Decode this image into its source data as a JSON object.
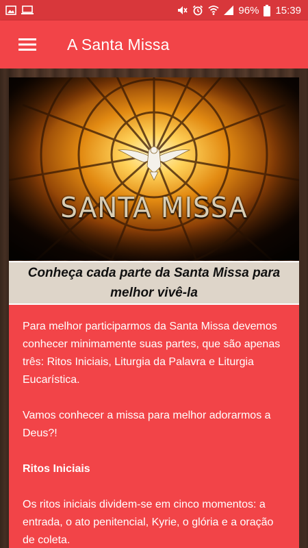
{
  "status_bar": {
    "battery": "96%",
    "time": "15:39",
    "left_icons": [
      "image-icon",
      "monitor-icon"
    ],
    "right_icons": [
      "mute-icon",
      "alarm-icon",
      "wifi-icon",
      "signal-icon",
      "battery-icon"
    ]
  },
  "app_bar": {
    "title": "A Santa Missa",
    "menu_icon": "hamburger-menu-icon"
  },
  "hero": {
    "title": "SANTA MISSA"
  },
  "caption": "Conheça cada parte da Santa Missa para melhor vivê-la",
  "content": {
    "paragraph_1": "Para melhor participarmos da Santa Missa devemos conhecer minimamente suas partes, que são apenas três: Ritos Iniciais, Liturgia da Palavra e Liturgia Eucarística.",
    "paragraph_2": "Vamos conhecer a missa para melhor adorarmos a Deus?!",
    "section_title": "Ritos Iniciais",
    "paragraph_3": "Os ritos iniciais dividem-se em cinco momentos: a entrada, o ato penitencial, Kyrie, o glória e a oração de coleta."
  },
  "colors": {
    "status_bar": "#d8373b",
    "app_bar": "#f24448",
    "card": "#f24448",
    "caption_bg": "#ded5c9"
  }
}
